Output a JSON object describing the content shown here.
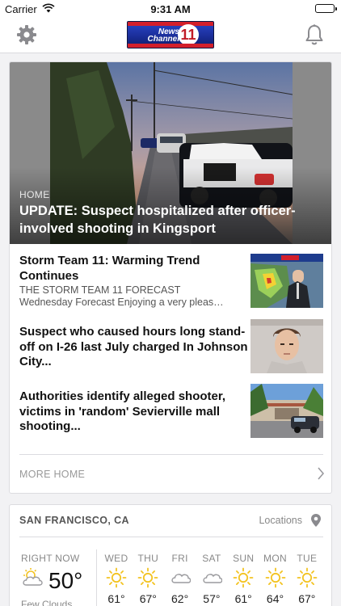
{
  "status_bar": {
    "carrier": "Carrier",
    "time": "9:31 AM"
  },
  "nav": {
    "logo_text_line1": "News",
    "logo_text_line2": "Channel",
    "logo_number": "11"
  },
  "featured": {
    "section": "HOME",
    "headline": "UPDATE: Suspect hospitalized after officer-involved shooting in Kingsport"
  },
  "stories": [
    {
      "title": "Storm Team 11: Warming Trend Continues",
      "kicker": "THE STORM TEAM 11 FORECAST",
      "description": "Wednesday Forecast Enjoying a very pleas…"
    },
    {
      "title": "Suspect who caused hours long stand-off on I-26 last July charged In Johnson City..."
    },
    {
      "title": "Authorities identify alleged shooter, victims in 'random' Sevierville mall shooting..."
    }
  ],
  "more": {
    "label": "MORE HOME"
  },
  "weather": {
    "city": "SAN FRANCISCO, CA",
    "locations_label": "Locations",
    "now": {
      "label": "RIGHT NOW",
      "temp": "50°",
      "condition": "Few Clouds",
      "icon": "partly-cloudy-icon"
    },
    "forecast": [
      {
        "day": "WED",
        "temp": "61°",
        "icon": "sun-icon"
      },
      {
        "day": "THU",
        "temp": "67°",
        "icon": "sun-icon"
      },
      {
        "day": "FRI",
        "temp": "62°",
        "icon": "cloud-icon"
      },
      {
        "day": "SAT",
        "temp": "57°",
        "icon": "cloud-icon"
      },
      {
        "day": "SUN",
        "temp": "61°",
        "icon": "sun-icon"
      },
      {
        "day": "MON",
        "temp": "64°",
        "icon": "sun-icon"
      },
      {
        "day": "TUE",
        "temp": "67°",
        "icon": "sun-icon"
      }
    ]
  },
  "colors": {
    "brand_blue": "#1b2e9a",
    "brand_red": "#d31f2b",
    "sun": "#f3c321",
    "icon_gray": "#8a8a8e"
  }
}
